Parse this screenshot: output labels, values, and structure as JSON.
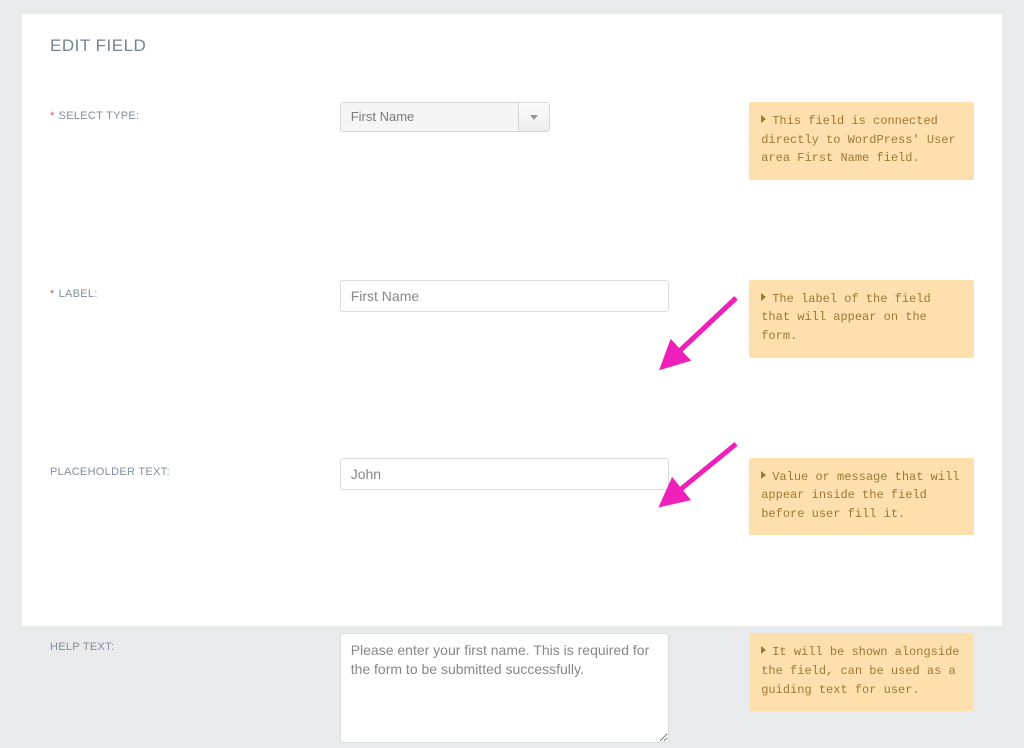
{
  "pageTitle": "EDIT FIELD",
  "fields": {
    "selectType": {
      "label": "SELECT TYPE:",
      "value": "First Name",
      "required": true,
      "tip": "This field is connected directly to WordPress' User area First Name field."
    },
    "label": {
      "label": "LABEL:",
      "value": "First Name",
      "required": true,
      "tip": "The label of the field that will appear on the form."
    },
    "placeholder": {
      "label": "PLACEHOLDER TEXT:",
      "value": "John",
      "required": false,
      "tip": "Value or message that will appear inside the field before user fill it."
    },
    "helpText": {
      "label": "HELP TEXT:",
      "value": "Please enter your first name. This is required for the form to be submitted successfully.",
      "required": false,
      "tip": "It will be shown alongside the field, can be used as a guiding text for user."
    }
  }
}
